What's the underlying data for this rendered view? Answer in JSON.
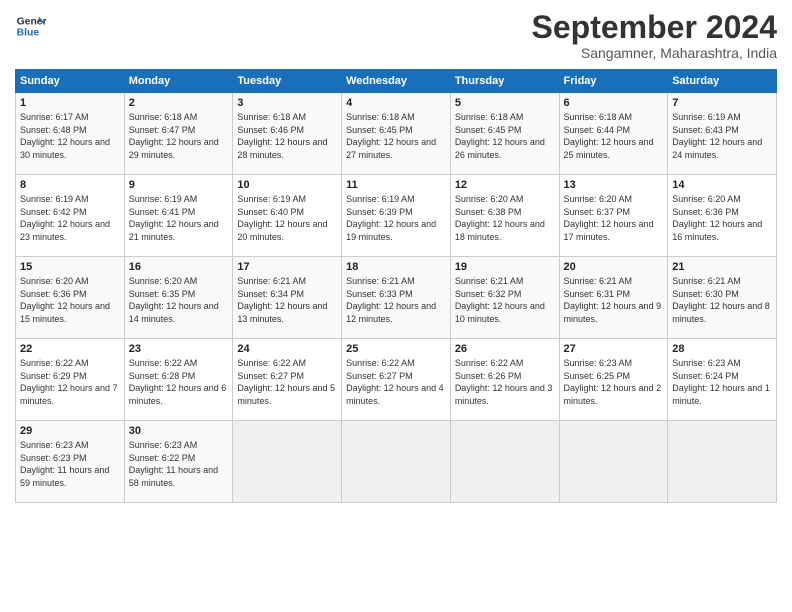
{
  "logo": {
    "line1": "General",
    "line2": "Blue"
  },
  "title": "September 2024",
  "subtitle": "Sangamner, Maharashtra, India",
  "weekdays": [
    "Sunday",
    "Monday",
    "Tuesday",
    "Wednesday",
    "Thursday",
    "Friday",
    "Saturday"
  ],
  "weeks": [
    [
      {
        "day": "1",
        "sunrise": "Sunrise: 6:17 AM",
        "sunset": "Sunset: 6:48 PM",
        "daylight": "Daylight: 12 hours and 30 minutes."
      },
      {
        "day": "2",
        "sunrise": "Sunrise: 6:18 AM",
        "sunset": "Sunset: 6:47 PM",
        "daylight": "Daylight: 12 hours and 29 minutes."
      },
      {
        "day": "3",
        "sunrise": "Sunrise: 6:18 AM",
        "sunset": "Sunset: 6:46 PM",
        "daylight": "Daylight: 12 hours and 28 minutes."
      },
      {
        "day": "4",
        "sunrise": "Sunrise: 6:18 AM",
        "sunset": "Sunset: 6:45 PM",
        "daylight": "Daylight: 12 hours and 27 minutes."
      },
      {
        "day": "5",
        "sunrise": "Sunrise: 6:18 AM",
        "sunset": "Sunset: 6:45 PM",
        "daylight": "Daylight: 12 hours and 26 minutes."
      },
      {
        "day": "6",
        "sunrise": "Sunrise: 6:18 AM",
        "sunset": "Sunset: 6:44 PM",
        "daylight": "Daylight: 12 hours and 25 minutes."
      },
      {
        "day": "7",
        "sunrise": "Sunrise: 6:19 AM",
        "sunset": "Sunset: 6:43 PM",
        "daylight": "Daylight: 12 hours and 24 minutes."
      }
    ],
    [
      {
        "day": "8",
        "sunrise": "Sunrise: 6:19 AM",
        "sunset": "Sunset: 6:42 PM",
        "daylight": "Daylight: 12 hours and 23 minutes."
      },
      {
        "day": "9",
        "sunrise": "Sunrise: 6:19 AM",
        "sunset": "Sunset: 6:41 PM",
        "daylight": "Daylight: 12 hours and 21 minutes."
      },
      {
        "day": "10",
        "sunrise": "Sunrise: 6:19 AM",
        "sunset": "Sunset: 6:40 PM",
        "daylight": "Daylight: 12 hours and 20 minutes."
      },
      {
        "day": "11",
        "sunrise": "Sunrise: 6:19 AM",
        "sunset": "Sunset: 6:39 PM",
        "daylight": "Daylight: 12 hours and 19 minutes."
      },
      {
        "day": "12",
        "sunrise": "Sunrise: 6:20 AM",
        "sunset": "Sunset: 6:38 PM",
        "daylight": "Daylight: 12 hours and 18 minutes."
      },
      {
        "day": "13",
        "sunrise": "Sunrise: 6:20 AM",
        "sunset": "Sunset: 6:37 PM",
        "daylight": "Daylight: 12 hours and 17 minutes."
      },
      {
        "day": "14",
        "sunrise": "Sunrise: 6:20 AM",
        "sunset": "Sunset: 6:36 PM",
        "daylight": "Daylight: 12 hours and 16 minutes."
      }
    ],
    [
      {
        "day": "15",
        "sunrise": "Sunrise: 6:20 AM",
        "sunset": "Sunset: 6:36 PM",
        "daylight": "Daylight: 12 hours and 15 minutes."
      },
      {
        "day": "16",
        "sunrise": "Sunrise: 6:20 AM",
        "sunset": "Sunset: 6:35 PM",
        "daylight": "Daylight: 12 hours and 14 minutes."
      },
      {
        "day": "17",
        "sunrise": "Sunrise: 6:21 AM",
        "sunset": "Sunset: 6:34 PM",
        "daylight": "Daylight: 12 hours and 13 minutes."
      },
      {
        "day": "18",
        "sunrise": "Sunrise: 6:21 AM",
        "sunset": "Sunset: 6:33 PM",
        "daylight": "Daylight: 12 hours and 12 minutes."
      },
      {
        "day": "19",
        "sunrise": "Sunrise: 6:21 AM",
        "sunset": "Sunset: 6:32 PM",
        "daylight": "Daylight: 12 hours and 10 minutes."
      },
      {
        "day": "20",
        "sunrise": "Sunrise: 6:21 AM",
        "sunset": "Sunset: 6:31 PM",
        "daylight": "Daylight: 12 hours and 9 minutes."
      },
      {
        "day": "21",
        "sunrise": "Sunrise: 6:21 AM",
        "sunset": "Sunset: 6:30 PM",
        "daylight": "Daylight: 12 hours and 8 minutes."
      }
    ],
    [
      {
        "day": "22",
        "sunrise": "Sunrise: 6:22 AM",
        "sunset": "Sunset: 6:29 PM",
        "daylight": "Daylight: 12 hours and 7 minutes."
      },
      {
        "day": "23",
        "sunrise": "Sunrise: 6:22 AM",
        "sunset": "Sunset: 6:28 PM",
        "daylight": "Daylight: 12 hours and 6 minutes."
      },
      {
        "day": "24",
        "sunrise": "Sunrise: 6:22 AM",
        "sunset": "Sunset: 6:27 PM",
        "daylight": "Daylight: 12 hours and 5 minutes."
      },
      {
        "day": "25",
        "sunrise": "Sunrise: 6:22 AM",
        "sunset": "Sunset: 6:27 PM",
        "daylight": "Daylight: 12 hours and 4 minutes."
      },
      {
        "day": "26",
        "sunrise": "Sunrise: 6:22 AM",
        "sunset": "Sunset: 6:26 PM",
        "daylight": "Daylight: 12 hours and 3 minutes."
      },
      {
        "day": "27",
        "sunrise": "Sunrise: 6:23 AM",
        "sunset": "Sunset: 6:25 PM",
        "daylight": "Daylight: 12 hours and 2 minutes."
      },
      {
        "day": "28",
        "sunrise": "Sunrise: 6:23 AM",
        "sunset": "Sunset: 6:24 PM",
        "daylight": "Daylight: 12 hours and 1 minute."
      }
    ],
    [
      {
        "day": "29",
        "sunrise": "Sunrise: 6:23 AM",
        "sunset": "Sunset: 6:23 PM",
        "daylight": "Daylight: 11 hours and 59 minutes."
      },
      {
        "day": "30",
        "sunrise": "Sunrise: 6:23 AM",
        "sunset": "Sunset: 6:22 PM",
        "daylight": "Daylight: 11 hours and 58 minutes."
      },
      null,
      null,
      null,
      null,
      null
    ]
  ]
}
